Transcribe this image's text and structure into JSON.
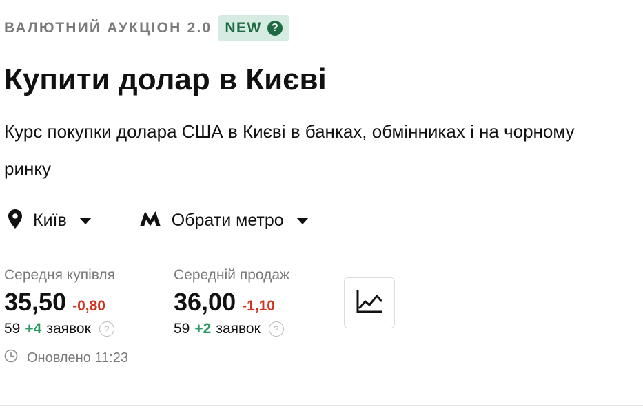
{
  "header": {
    "kicker": "ВАЛЮТНИЙ АУКЦІОН 2.0",
    "badge": "NEW",
    "badge_help": "?"
  },
  "title": "Купити долар в Києві",
  "subtitle": "Курс покупки долара США в Києві в банках, обмінниках і на чорному ринку",
  "selectors": {
    "city": {
      "label": "Київ",
      "icon": "location-pin-icon"
    },
    "metro": {
      "label": "Обрати метро",
      "icon": "metro-icon"
    }
  },
  "stats": {
    "buy": {
      "label": "Середня купівля",
      "value": "35,50",
      "delta": "-0,80",
      "orders_count": "59",
      "orders_delta": "+4",
      "orders_word": "заявок"
    },
    "sell": {
      "label": "Середній продаж",
      "value": "36,00",
      "delta": "-1,10",
      "orders_count": "59",
      "orders_delta": "+2",
      "orders_word": "заявок"
    },
    "help": "?"
  },
  "chart_button": {
    "icon": "line-chart-icon"
  },
  "updated": {
    "icon": "clock-icon",
    "text": "Оновлено 11:23"
  },
  "colors": {
    "negative": "#d2331f",
    "positive": "#2a9a62",
    "badge_bg": "#d6ece2",
    "badge_text": "#1e6b43",
    "muted": "#7a7a7a"
  }
}
